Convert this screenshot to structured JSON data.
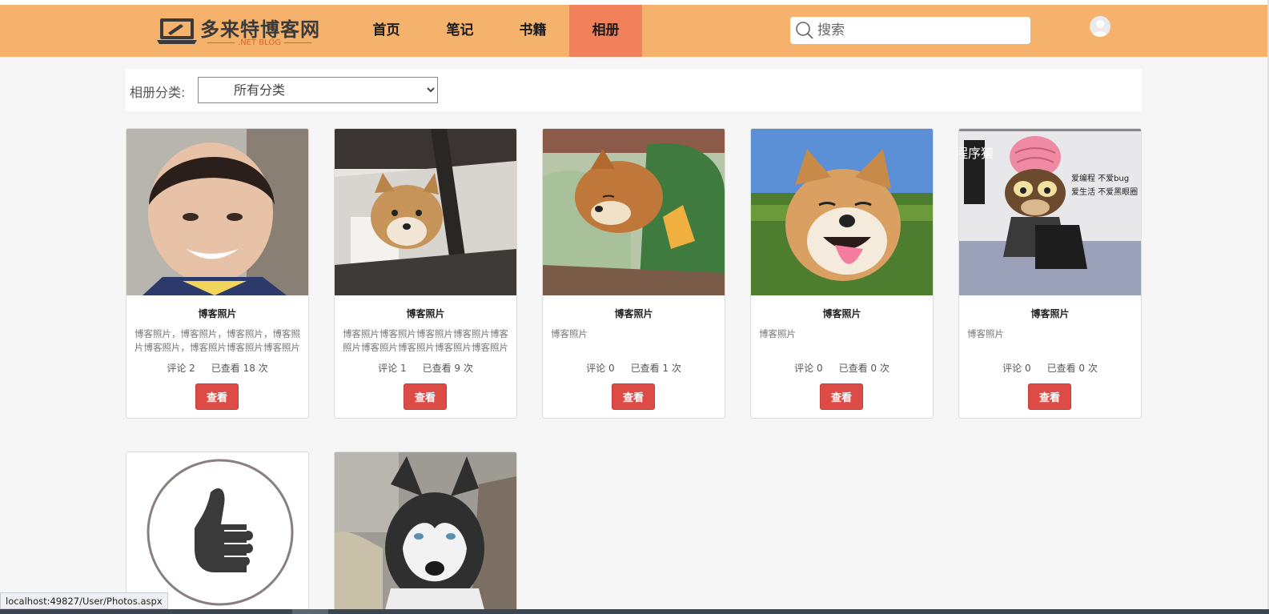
{
  "site": {
    "logo_text": "多来特博客网",
    "logo_sub": ".NET BLOG"
  },
  "nav": {
    "items": [
      {
        "label": "首页"
      },
      {
        "label": "笔记"
      },
      {
        "label": "书籍"
      },
      {
        "label": "相册",
        "active": true
      }
    ]
  },
  "search": {
    "placeholder": "搜索"
  },
  "filter": {
    "label": "相册分类:",
    "selected": "所有分类"
  },
  "photos": [
    {
      "title": "博客照片",
      "desc": "博客照片，博客照片，博客照片，博客照片博客照片，博客照片博客照片博客照片",
      "comments": "评论 2",
      "views": "已查看 18 次",
      "button": "查看",
      "image": "child"
    },
    {
      "title": "博客照片",
      "desc": "博客照片博客照片博客照片博客照片博客照片博客照片博客照片博客照片博客照片博客",
      "comments": "评论 1",
      "views": "已查看 9 次",
      "button": "查看",
      "image": "shiba-chair"
    },
    {
      "title": "博客照片",
      "desc": "博客照片",
      "comments": "评论 0",
      "views": "已查看 1 次",
      "button": "查看",
      "image": "shiba-sleeping"
    },
    {
      "title": "博客照片",
      "desc": "博客照片",
      "comments": "评论 0",
      "views": "已查看 0 次",
      "button": "查看",
      "image": "shiba-smiling"
    },
    {
      "title": "博客照片",
      "desc": "博客照片",
      "comments": "评论 0",
      "views": "已查看 0 次",
      "button": "查看",
      "image": "programmer-monkey",
      "image_text": [
        "程序猿",
        "爱编程 不爱bug",
        "爱生活 不爱黑眼圈"
      ]
    },
    {
      "image": "thumbs-up"
    },
    {
      "image": "husky"
    }
  ],
  "status_bar": {
    "url": "localhost:49827/User/Photos.aspx"
  },
  "colors": {
    "header": "#f4b26d",
    "nav_active": "#f2805a",
    "button": "#dc4b45",
    "page_bg": "#f6f6f6"
  }
}
